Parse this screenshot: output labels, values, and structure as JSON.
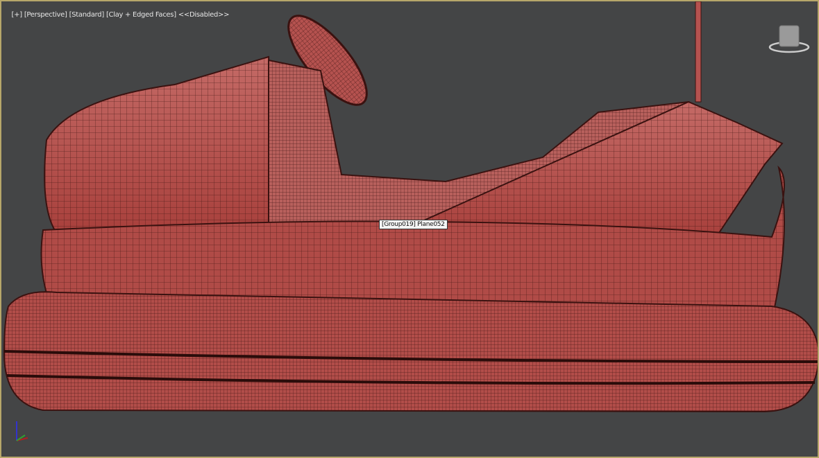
{
  "viewport": {
    "labels": [
      "[+]",
      "[Perspective]",
      "[Standard]",
      "[Clay + Edged Faces]",
      "<<Disabled>>"
    ],
    "tooltip": "[Group019] Plane052"
  },
  "colors": {
    "background": "#444546",
    "mesh": "#b5524f",
    "wire": "#3a1210",
    "active_border": "#b7a76a"
  }
}
